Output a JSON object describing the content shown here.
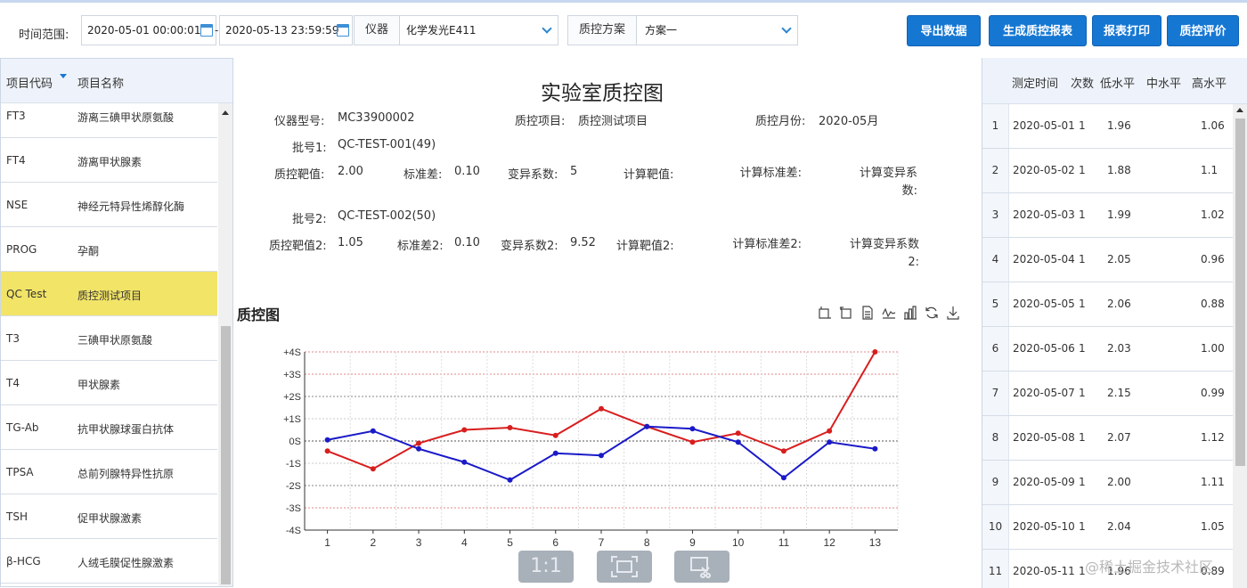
{
  "toolbar": {
    "time_label": "时间范围:",
    "start_date": "2020-05-01 00:00:01",
    "date_separator": "-",
    "end_date": "2020-05-13 23:59:59",
    "instrument_label": "仪器",
    "instrument_value": "化学发光E411",
    "scheme_label": "质控方案",
    "scheme_value": "方案一",
    "buttons": [
      "导出数据",
      "生成质控报表",
      "报表打印",
      "质控评价"
    ]
  },
  "left_panel": {
    "col_code": "项目代码",
    "col_name": "项目名称",
    "items": [
      {
        "code": "FT3",
        "name": "游离三碘甲状原氨酸"
      },
      {
        "code": "FT4",
        "name": "游离甲状腺素"
      },
      {
        "code": "NSE",
        "name": "神经元特异性烯醇化酶"
      },
      {
        "code": "PROG",
        "name": "孕酮"
      },
      {
        "code": "QC Test",
        "name": "质控测试项目"
      },
      {
        "code": "T3",
        "name": "三碘甲状原氨酸"
      },
      {
        "code": "T4",
        "name": "甲状腺素"
      },
      {
        "code": "TG-Ab",
        "name": "抗甲状腺球蛋白抗体"
      },
      {
        "code": "TPSA",
        "name": "总前列腺特异性抗原"
      },
      {
        "code": "TSH",
        "name": "促甲状腺激素"
      },
      {
        "code": "β-HCG",
        "name": "人绒毛膜促性腺激素"
      }
    ],
    "selected_index": 4
  },
  "report": {
    "title": "实验室质控图",
    "instrument_model_label": "仪器型号:",
    "instrument_model": "MC33900002",
    "qc_item_label": "质控项目:",
    "qc_item": "质控测试项目",
    "qc_month_label": "质控月份:",
    "qc_month": "2020-05月",
    "lot1_label": "批号1:",
    "lot1": "QC-TEST-001(49)",
    "target1_label": "质控靶值:",
    "target1": "2.00",
    "sd1_label": "标准差:",
    "sd1": "0.10",
    "cv1_label": "变异系数:",
    "cv1": "5",
    "calc_target1_label": "计算靶值:",
    "calc_sd1_label": "计算标准差:",
    "calc_cv1_label": "计算变异系数:",
    "lot2_label": "批号2:",
    "lot2": "QC-TEST-002(50)",
    "target2_label": "质控靶值2:",
    "target2": "1.05",
    "sd2_label": "标准差2:",
    "sd2": "0.10",
    "cv2_label": "变异系数2:",
    "cv2": "9.52",
    "calc_target2_label": "计算靶值2:",
    "calc_sd2_label": "计算标准差2:",
    "calc_cv2_label": "计算变异系数2:"
  },
  "chart_section": {
    "title": "质控图",
    "tool_icons": [
      "zoom-select-icon",
      "zoom-reset-icon",
      "data-view-icon",
      "line-chart-icon",
      "bar-chart-icon",
      "restore-icon",
      "save-image-icon"
    ],
    "zoom_buttons": [
      "1:1"
    ]
  },
  "chart_data": {
    "type": "line",
    "x": [
      1,
      2,
      3,
      4,
      5,
      6,
      7,
      8,
      9,
      10,
      11,
      12,
      13
    ],
    "y_ticks": [
      "+4S",
      "+3S",
      "+2S",
      "+1S",
      "0S",
      "-1S",
      "-2S",
      "-3S",
      "-4S"
    ],
    "ylim": [
      -4,
      4
    ],
    "series": [
      {
        "color": "#d81e1e",
        "values": [
          -0.45,
          -1.25,
          -0.1,
          0.5,
          0.6,
          0.25,
          1.45,
          0.65,
          -0.05,
          0.35,
          -0.45,
          0.45,
          4.0
        ]
      },
      {
        "color": "#1a1ac8",
        "values": [
          0.05,
          0.45,
          -0.35,
          -0.95,
          -1.75,
          -0.55,
          -0.65,
          0.65,
          0.55,
          -0.05,
          -1.65,
          -0.05,
          -0.35
        ]
      }
    ]
  },
  "right_panel": {
    "headers": [
      "测定时间",
      "次数",
      "低水平",
      "中水平",
      "高水平"
    ],
    "rows": [
      {
        "idx": "1",
        "date": "2020-05-01",
        "count": "1",
        "low": "1.96",
        "high": "1.06"
      },
      {
        "idx": "2",
        "date": "2020-05-02",
        "count": "1",
        "low": "1.88",
        "high": "1.1"
      },
      {
        "idx": "3",
        "date": "2020-05-03",
        "count": "1",
        "low": "1.99",
        "high": "1.02"
      },
      {
        "idx": "4",
        "date": "2020-05-04",
        "count": "1",
        "low": "2.05",
        "high": "0.96"
      },
      {
        "idx": "5",
        "date": "2020-05-05",
        "count": "1",
        "low": "2.06",
        "high": "0.88"
      },
      {
        "idx": "6",
        "date": "2020-05-06",
        "count": "1",
        "low": "2.03",
        "high": "1.00"
      },
      {
        "idx": "7",
        "date": "2020-05-07",
        "count": "1",
        "low": "2.15",
        "high": "0.99"
      },
      {
        "idx": "8",
        "date": "2020-05-08",
        "count": "1",
        "low": "2.07",
        "high": "1.12"
      },
      {
        "idx": "9",
        "date": "2020-05-09",
        "count": "1",
        "low": "2.00",
        "high": "1.11"
      },
      {
        "idx": "10",
        "date": "2020-05-10",
        "count": "1",
        "low": "2.04",
        "high": "1.05"
      },
      {
        "idx": "11",
        "date": "2020-05-11",
        "count": "1",
        "low": "1.96",
        "high": "0.89"
      }
    ]
  },
  "watermark": "@稀土掘金技术社区"
}
